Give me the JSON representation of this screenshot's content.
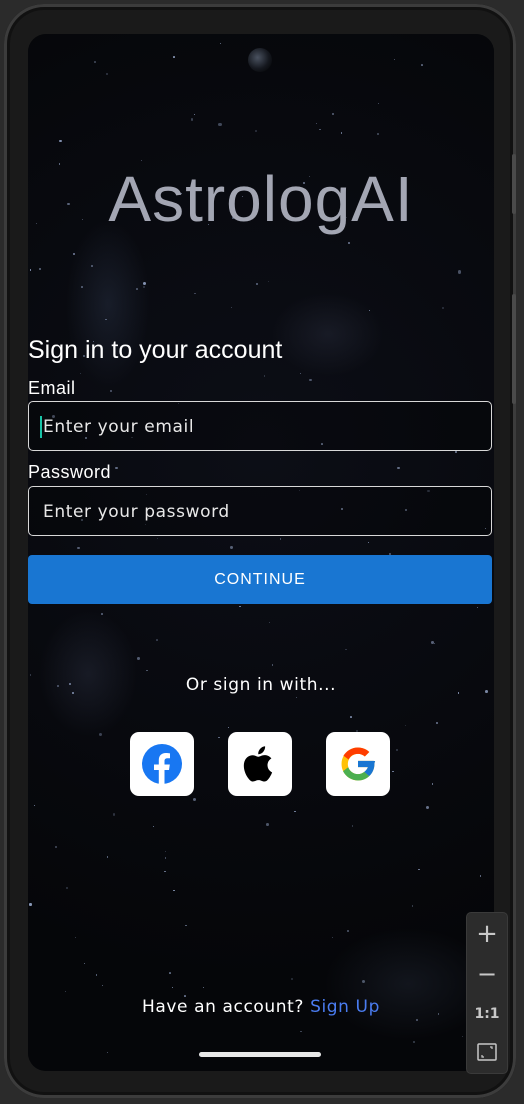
{
  "app": {
    "title": "AstrologAI"
  },
  "signin": {
    "heading": "Sign in to your account",
    "email_label": "Email",
    "email_placeholder": "Enter your email",
    "email_value": "",
    "password_label": "Password",
    "password_placeholder": "Enter your password",
    "password_value": "",
    "continue_label": "CONTINUE"
  },
  "social": {
    "prompt": "Or sign in with...",
    "providers": [
      {
        "name": "facebook",
        "icon": "facebook-icon",
        "color": "#1877f2"
      },
      {
        "name": "apple",
        "icon": "apple-icon",
        "color": "#000000"
      },
      {
        "name": "google",
        "icon": "google-icon",
        "color": "#4285f4"
      }
    ]
  },
  "footer": {
    "question": "Have an account?",
    "link": "Sign Up"
  },
  "emulator": {
    "zoom_in": "+",
    "zoom_out": "−",
    "actual_size": "1:1"
  },
  "colors": {
    "accent": "#1976d2",
    "link": "#4a7cf0",
    "title": "#a3a6b3",
    "caret": "#19c4a8"
  }
}
